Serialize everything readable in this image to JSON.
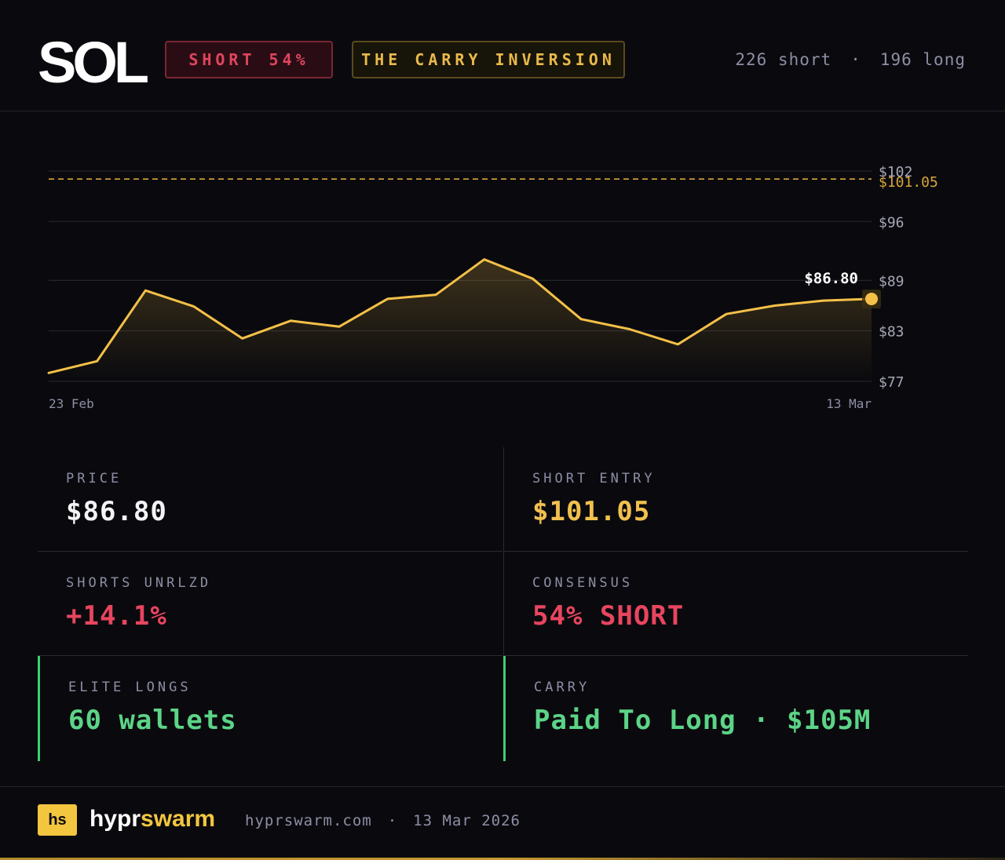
{
  "header": {
    "ticker": "SOL",
    "position_badge": "SHORT 54%",
    "thesis_badge": "THE CARRY INVERSION",
    "short_count": "226 short",
    "separator": "·",
    "long_count": "196 long"
  },
  "chart_data": {
    "type": "line",
    "title": "",
    "xlabel": "",
    "ylabel": "",
    "x_start_label": "23 Feb",
    "x_end_label": "13 Mar",
    "y_ticks": [
      77,
      83,
      89,
      96,
      102
    ],
    "y_tick_labels": [
      "$77",
      "$83",
      "$89",
      "$96",
      "$102"
    ],
    "ylim": [
      77,
      102
    ],
    "grid": true,
    "series": [
      {
        "values": [
          78.0,
          79.4,
          87.8,
          85.9,
          82.1,
          84.2,
          83.5,
          86.8,
          87.3,
          91.5,
          89.2,
          84.4,
          83.2,
          81.4,
          85.0,
          86.0,
          86.6,
          86.8
        ],
        "color": "#f4c048"
      }
    ],
    "reference_line": {
      "value": 101.05,
      "label": "$101.05",
      "color": "#d9a53a"
    },
    "last_value_label": "$86.80"
  },
  "stats": {
    "price": {
      "label": "PRICE",
      "value": "$86.80"
    },
    "short_entry": {
      "label": "SHORT ENTRY",
      "value": "$101.05"
    },
    "shorts_unrlzd": {
      "label": "SHORTS UNRLZD",
      "value": "+14.1%"
    },
    "consensus": {
      "label": "CONSENSUS",
      "value": "54% SHORT"
    },
    "elite_longs": {
      "label": "ELITE LONGS",
      "value": "60 wallets"
    },
    "carry": {
      "label": "CARRY",
      "value": "Paid To Long · $105M"
    }
  },
  "footer": {
    "logo_text": "hs",
    "brand_part1": "hypr",
    "brand_part2": "swarm",
    "site": "hyprswarm.com",
    "separator": "·",
    "date": "13 Mar 2026"
  },
  "colors": {
    "background": "#0a0a0e",
    "accent_gold": "#f3c63f",
    "short_red": "#e8455f",
    "long_green": "#5cd487"
  }
}
